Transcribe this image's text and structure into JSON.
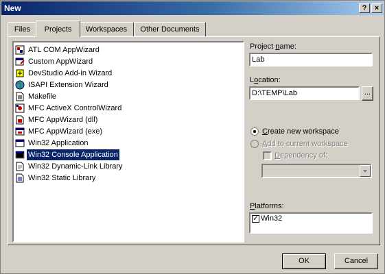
{
  "window": {
    "title": "New",
    "help_label": "?",
    "close_label": "×"
  },
  "tabs": [
    {
      "label": "Files",
      "active": false
    },
    {
      "label": "Projects",
      "active": true
    },
    {
      "label": "Workspaces",
      "active": false
    },
    {
      "label": "Other Documents",
      "active": false
    }
  ],
  "project_types": [
    {
      "label": "ATL COM AppWizard",
      "icon": "atl-com-appwizard-icon",
      "selected": false
    },
    {
      "label": "Custom AppWizard",
      "icon": "custom-appwizard-icon",
      "selected": false
    },
    {
      "label": "DevStudio Add-in Wizard",
      "icon": "devstudio-addin-icon",
      "selected": false
    },
    {
      "label": "ISAPI Extension Wizard",
      "icon": "isapi-globe-icon",
      "selected": false
    },
    {
      "label": "Makefile",
      "icon": "makefile-icon",
      "selected": false
    },
    {
      "label": "MFC ActiveX ControlWizard",
      "icon": "mfc-activex-icon",
      "selected": false
    },
    {
      "label": "MFC AppWizard (dll)",
      "icon": "mfc-dll-icon",
      "selected": false
    },
    {
      "label": "MFC AppWizard (exe)",
      "icon": "mfc-exe-icon",
      "selected": false
    },
    {
      "label": "Win32 Application",
      "icon": "win32-app-icon",
      "selected": false
    },
    {
      "label": "Win32 Console Application",
      "icon": "console-window-icon",
      "selected": true
    },
    {
      "label": "Win32 Dynamic-Link Library",
      "icon": "dll-document-icon",
      "selected": false
    },
    {
      "label": "Win32 Static Library",
      "icon": "static-library-icon",
      "selected": false
    }
  ],
  "project_name": {
    "label_pre": "Project ",
    "label_key": "n",
    "label_post": "ame:",
    "value": "Lab"
  },
  "location": {
    "label_key": "o",
    "label_pre": "L",
    "label_post": "cation:",
    "value": "D:\\TEMP\\Lab",
    "browse_label": "..."
  },
  "workspace": {
    "create_pre": "",
    "create_key": "C",
    "create_post": "reate new workspace",
    "add_pre": "",
    "add_key": "A",
    "add_post": "dd to current workspace",
    "dependency_pre": "",
    "dependency_key": "D",
    "dependency_post": "ependency of:",
    "selected": "create"
  },
  "platforms": {
    "label_pre": "",
    "label_key": "P",
    "label_post": "latforms:",
    "items": [
      {
        "label": "Win32",
        "checked": true
      }
    ]
  },
  "buttons": {
    "ok_label": "OK",
    "cancel_label": "Cancel"
  },
  "colors": {
    "title_start": "#0a246a",
    "title_end": "#a6caf0",
    "selection": "#0a246a",
    "face": "#d4d0c8"
  }
}
